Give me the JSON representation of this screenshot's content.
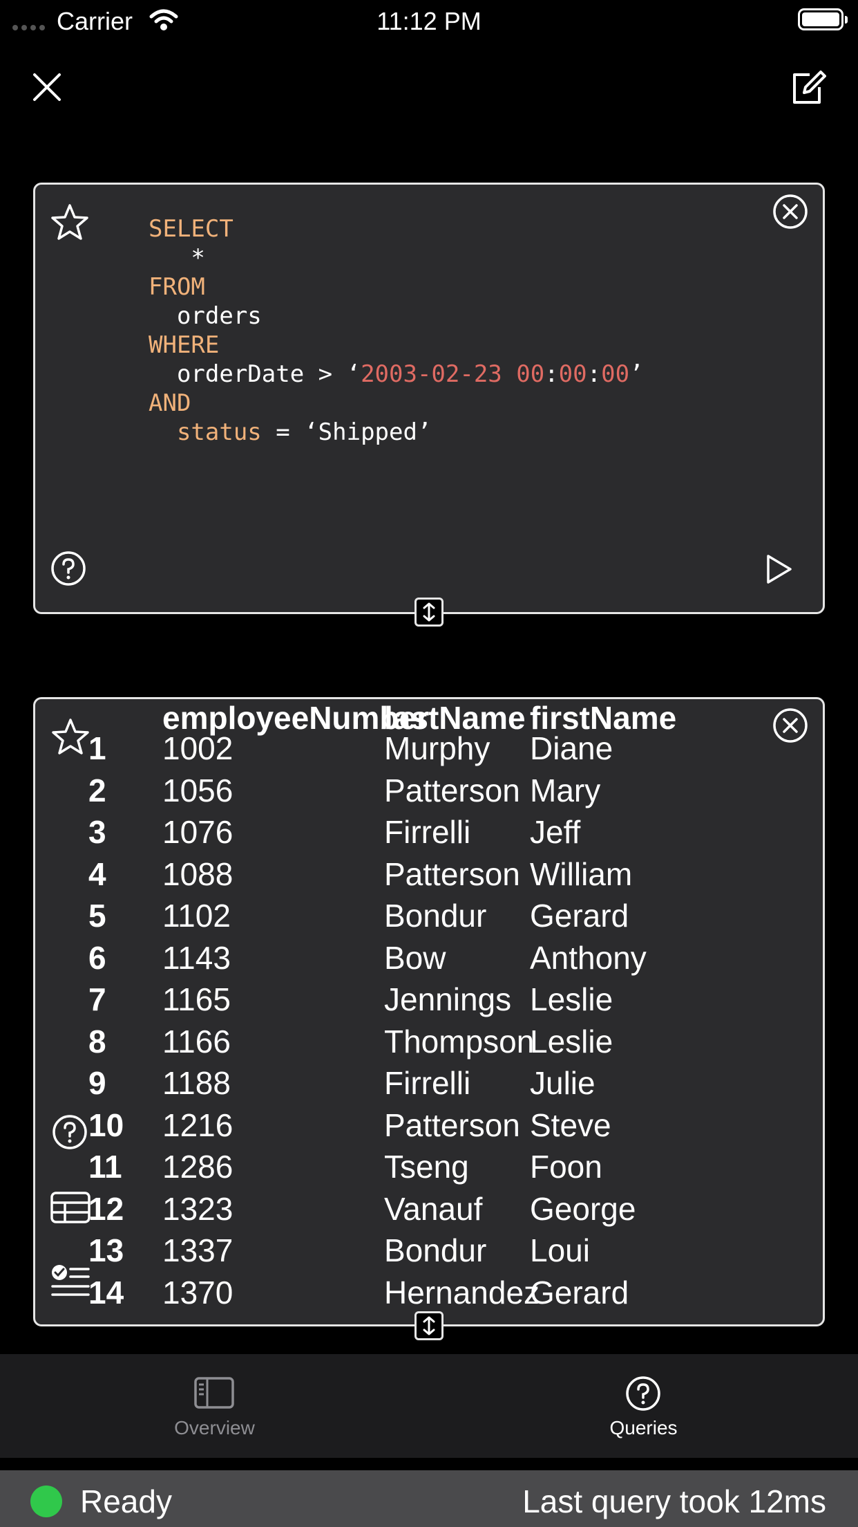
{
  "status_bar": {
    "carrier": "Carrier",
    "time": "11:12 PM"
  },
  "header": {
    "close_icon": "close-icon",
    "compose_icon": "compose-icon"
  },
  "query_editor": {
    "lines": [
      {
        "indent": "",
        "parts": [
          {
            "t": "SELECT",
            "c": "kw"
          }
        ]
      },
      {
        "indent": "   ",
        "parts": [
          {
            "t": "*",
            "c": ""
          }
        ]
      },
      {
        "indent": "",
        "parts": [
          {
            "t": "FROM",
            "c": "kw"
          }
        ]
      },
      {
        "indent": "  ",
        "parts": [
          {
            "t": "orders",
            "c": ""
          }
        ]
      },
      {
        "indent": "",
        "parts": [
          {
            "t": "WHERE",
            "c": "kw"
          }
        ]
      },
      {
        "indent": "  ",
        "parts": [
          {
            "t": "orderDate > ‘",
            "c": ""
          },
          {
            "t": "2003-02-23 00",
            "c": "str"
          },
          {
            "t": ":",
            "c": ""
          },
          {
            "t": "00",
            "c": "str"
          },
          {
            "t": ":",
            "c": ""
          },
          {
            "t": "00",
            "c": "str"
          },
          {
            "t": "’",
            "c": ""
          }
        ]
      },
      {
        "indent": "",
        "parts": [
          {
            "t": "AND",
            "c": "kw"
          }
        ]
      },
      {
        "indent": "  ",
        "parts": [
          {
            "t": "status",
            "c": "kw"
          },
          {
            "t": " = ‘Shipped’",
            "c": ""
          }
        ]
      }
    ]
  },
  "results": {
    "columns": [
      "employeeNumber",
      "lastName",
      "firstName"
    ],
    "rows": [
      {
        "n": "1",
        "employeeNumber": "1002",
        "lastName": "Murphy",
        "firstName": "Diane"
      },
      {
        "n": "2",
        "employeeNumber": "1056",
        "lastName": "Patterson",
        "firstName": "Mary"
      },
      {
        "n": "3",
        "employeeNumber": "1076",
        "lastName": "Firrelli",
        "firstName": "Jeff"
      },
      {
        "n": "4",
        "employeeNumber": "1088",
        "lastName": "Patterson",
        "firstName": "William"
      },
      {
        "n": "5",
        "employeeNumber": "1102",
        "lastName": "Bondur",
        "firstName": "Gerard"
      },
      {
        "n": "6",
        "employeeNumber": "1143",
        "lastName": "Bow",
        "firstName": "Anthony"
      },
      {
        "n": "7",
        "employeeNumber": "1165",
        "lastName": "Jennings",
        "firstName": "Leslie"
      },
      {
        "n": "8",
        "employeeNumber": "1166",
        "lastName": "Thompson",
        "firstName": "Leslie"
      },
      {
        "n": "9",
        "employeeNumber": "1188",
        "lastName": "Firrelli",
        "firstName": "Julie"
      },
      {
        "n": "10",
        "employeeNumber": "1216",
        "lastName": "Patterson",
        "firstName": "Steve"
      },
      {
        "n": "11",
        "employeeNumber": "1286",
        "lastName": "Tseng",
        "firstName": "Foon"
      },
      {
        "n": "12",
        "employeeNumber": "1323",
        "lastName": "Vanauf",
        "firstName": "George"
      },
      {
        "n": "13",
        "employeeNumber": "1337",
        "lastName": "Bondur",
        "firstName": "Loui"
      },
      {
        "n": "14",
        "employeeNumber": "1370",
        "lastName": "Hernandez",
        "firstName": "Gerard"
      }
    ]
  },
  "tabs": [
    {
      "label": "Overview",
      "icon": "sidebar-icon",
      "active": false
    },
    {
      "label": "Queries",
      "icon": "question-circle-icon",
      "active": true
    }
  ],
  "footer": {
    "status": "Ready",
    "last_query": "Last query took 12ms",
    "status_color": "#30c84b"
  },
  "colors": {
    "keyword": "#f1b27a",
    "string": "#e06b63",
    "panel": "#2b2b2d",
    "inactive_tab": "#8e8e93"
  }
}
